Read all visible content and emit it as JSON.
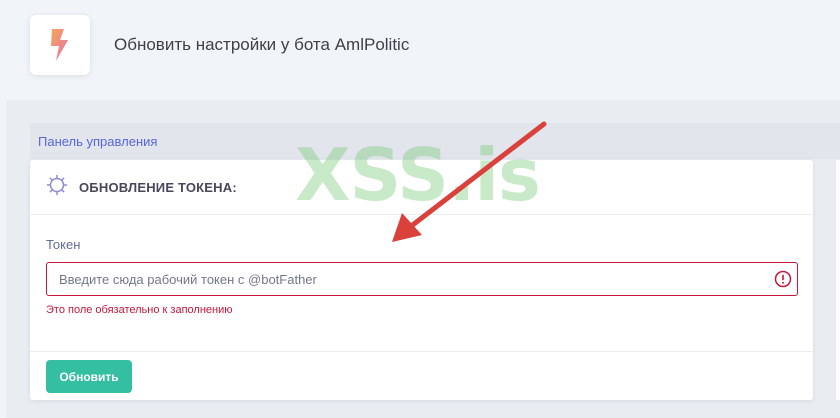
{
  "header": {
    "title": "Обновить настройки у бота AmlPolitic",
    "logo_icon": "lightning-bolt-icon"
  },
  "breadcrumb": {
    "label": "Панель управления"
  },
  "card": {
    "title": "ОБНОВЛЕНИЕ ТОКЕНА:",
    "title_icon": "gear-icon",
    "field": {
      "label": "Токен",
      "value": "",
      "placeholder": "Введите сюда рабочий токен с @botFather",
      "error": "Это поле обязательно к заполнению",
      "error_icon": "exclamation-circle-icon"
    },
    "submit_label": "Обновить"
  },
  "watermark": "XSS.is",
  "colors": {
    "accent": "#5867dd",
    "success": "#34bfa3",
    "danger": "#c4173a",
    "watermark": "#70c870",
    "arrow": "#d9413a"
  }
}
